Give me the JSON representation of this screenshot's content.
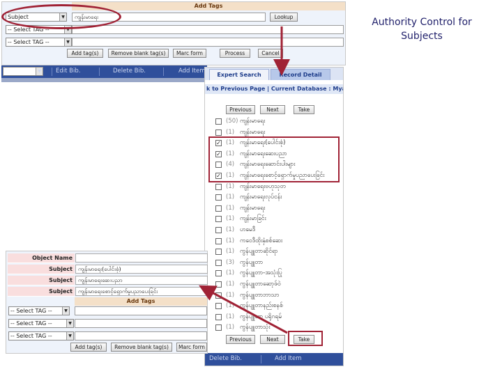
{
  "slide_title": {
    "line1": "Authority Control for",
    "line2": "Subjects"
  },
  "top_form": {
    "header": "Add Tags",
    "rows": [
      {
        "select": "Subject",
        "value": "ကျန်းမာရေး"
      },
      {
        "select": "-- Select TAG --",
        "value": ""
      },
      {
        "select": "-- Select TAG --",
        "value": ""
      }
    ],
    "lookup_button": "Lookup",
    "buttons": [
      "Add tag(s)",
      "Remove blank tag(s)",
      "Marc form",
      "Process",
      "Cancel"
    ]
  },
  "left_navbar": {
    "items": [
      "Edit Bib.",
      "Delete Bib.",
      "Add Item"
    ]
  },
  "search_window": {
    "tabs": [
      "Expert Search",
      "Record Detail"
    ],
    "breadcrumb": "k to Previous Page | Current Database : Myanm",
    "pager_top": [
      "Previous",
      "Next",
      "Take"
    ],
    "pager_bottom": [
      "Previous",
      "Next",
      "Take"
    ],
    "results": [
      {
        "checked": false,
        "count": "(50)",
        "term": "ကျန်းမာရေး"
      },
      {
        "checked": false,
        "count": "(1)",
        "term": "ကျန်းမာရေး"
      },
      {
        "checked": true,
        "count": "(1)",
        "term": "ကျန်းမာရေး(ပေါင်းစုံ)"
      },
      {
        "checked": true,
        "count": "(1)",
        "term": "ကျန်းမာရေးဆေးပညာ"
      },
      {
        "checked": false,
        "count": "(4)",
        "term": "ကျန်းမာရေးဆောင်းပါးများ"
      },
      {
        "checked": true,
        "count": "(1)",
        "term": "ကျန်းမာရေးစောင့်ရှောက်မှုပညာပေးခြင်း"
      },
      {
        "checked": false,
        "count": "(1)",
        "term": "ကျန်းမာရေးဗဟုသုတ"
      },
      {
        "checked": false,
        "count": "(1)",
        "term": "ကျန်းမာရေးလုပ်ငန်း"
      },
      {
        "checked": false,
        "count": "(1)",
        "term": "ကျန်းမာရေး"
      },
      {
        "checked": false,
        "count": "(1)",
        "term": "ကျန်းမာခြင်း"
      },
      {
        "checked": false,
        "count": "(1)",
        "term": "ဟမေဒီ"
      },
      {
        "checked": false,
        "count": "(1)",
        "term": "ကဝေဒီထိုးနှံစစ်ဆေး"
      },
      {
        "checked": false,
        "count": "(1)",
        "term": "ကွန်ပျူတာဆိုင်ရာ"
      },
      {
        "checked": false,
        "count": "(3)",
        "term": "ကွန်ပျူတာ"
      },
      {
        "checked": false,
        "count": "(1)",
        "term": "ကွန်ပျူတာ-အသုံးပြု"
      },
      {
        "checked": false,
        "count": "(1)",
        "term": "ကွန်ပျူတာဆော့ဖ်ဝဲ"
      },
      {
        "checked": false,
        "count": "(1)",
        "term": "ကွန်ပျူတာဘာသာ"
      },
      {
        "checked": false,
        "count": "(1)",
        "term": "ကွန်ပျူတာနည်းစနစ်"
      },
      {
        "checked": false,
        "count": "(1)",
        "term": "ကွန်ပျူတာ ပရိုဂရမ်"
      },
      {
        "checked": false,
        "count": "(1)",
        "term": "ကွန်ပျူတာသုံး"
      }
    ],
    "bottom_navbar": [
      "Delete Bib.",
      "Add Item"
    ]
  },
  "bottom_form": {
    "rows": [
      {
        "label": "Object Name",
        "value": ""
      },
      {
        "label": "Subject",
        "value": "ကျန်းမာရေး(ပေါင်းစုံ)"
      },
      {
        "label": "Subject",
        "value": "ကျန်းမာရေးဆေးပညာ"
      },
      {
        "label": "Subject",
        "value": "ကျန်းမာရေးစောင့်ရှောက်မှုပညာပေးခြင်း"
      }
    ],
    "header": "Add Tags",
    "tag_selects": [
      "-- Select TAG --",
      "-- Select TAG --",
      "-- Select TAG --"
    ],
    "buttons": [
      "Add tag(s)",
      "Remove blank tag(s)",
      "Marc form"
    ]
  },
  "colors": {
    "annotation": "#a02235",
    "navbar": "#2f4f9b",
    "header_tan": "#f4e0c8",
    "label_pink": "#f9dede"
  }
}
